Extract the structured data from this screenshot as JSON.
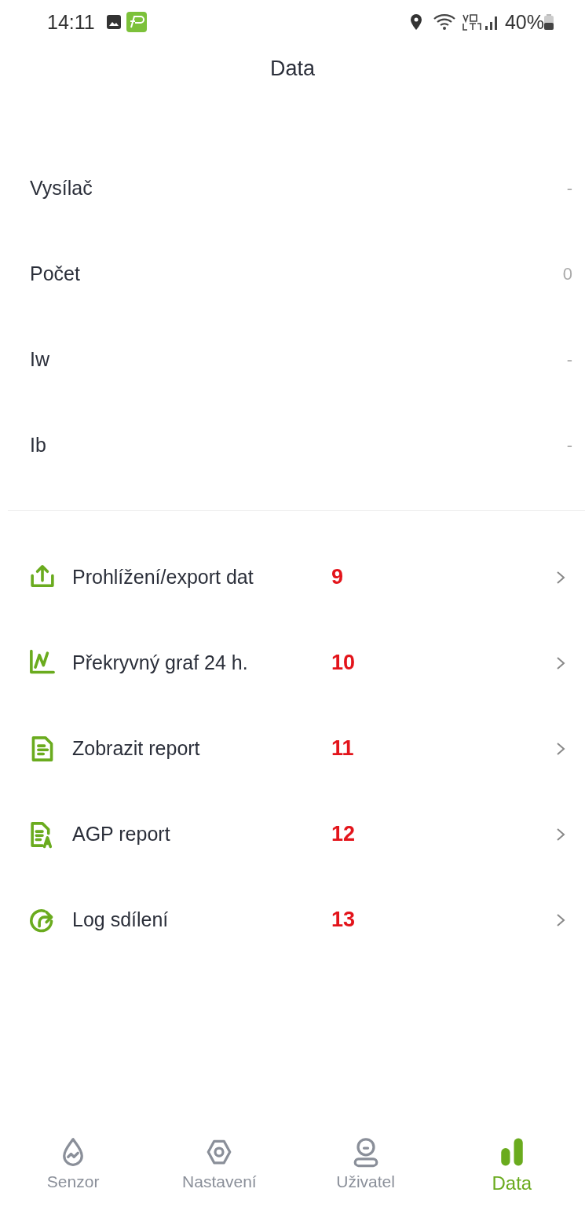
{
  "status_bar": {
    "time": "14:11",
    "battery": "40%"
  },
  "title": "Data",
  "info_rows": [
    {
      "label": "Vysílač",
      "value": "-"
    },
    {
      "label": "Počet",
      "value": "0"
    },
    {
      "label": "Iw",
      "value": "-"
    },
    {
      "label": "Ib",
      "value": "-"
    }
  ],
  "menu_items": [
    {
      "kind": "export",
      "label": "Prohlížení/export dat",
      "annotation": "9"
    },
    {
      "kind": "chart",
      "label": "Překryvný graf 24 h.",
      "annotation": "10"
    },
    {
      "kind": "report",
      "label": "Zobrazit report",
      "annotation": "11"
    },
    {
      "kind": "agp",
      "label": "AGP report",
      "annotation": "12"
    },
    {
      "kind": "share",
      "label": "Log sdílení",
      "annotation": "13"
    }
  ],
  "tabs": [
    {
      "kind": "sensor",
      "label": "Senzor",
      "selected": false
    },
    {
      "kind": "settings",
      "label": "Nastavení",
      "selected": false
    },
    {
      "kind": "user",
      "label": "Uživatel",
      "selected": false
    },
    {
      "kind": "data",
      "label": "Data",
      "selected": true
    }
  ]
}
